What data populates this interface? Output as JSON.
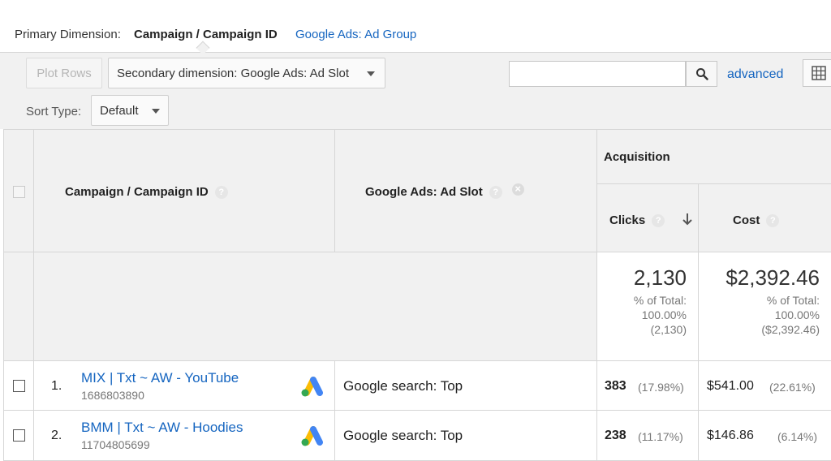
{
  "dimensions": {
    "label": "Primary Dimension:",
    "active": "Campaign / Campaign ID",
    "link": "Google Ads: Ad Group"
  },
  "toolbar": {
    "plot_rows": "Plot Rows",
    "secondary_dimension": "Secondary dimension: Google Ads: Ad Slot",
    "search_value": "",
    "advanced": "advanced",
    "sort_label": "Sort Type:",
    "sort_value": "Default"
  },
  "table": {
    "group_header": "Acquisition",
    "col_campaign": "Campaign / Campaign ID",
    "col_slot": "Google Ads: Ad Slot",
    "col_clicks": "Clicks",
    "col_cost": "Cost",
    "help_glyph": "?",
    "remove_glyph": "×",
    "totals": {
      "clicks": "2,130",
      "clicks_pct_label": "% of Total:",
      "clicks_pct": "100.00%",
      "clicks_abs": "(2,130)",
      "cost": "$2,392.46",
      "cost_pct_label": "% of Total:",
      "cost_pct": "100.00%",
      "cost_abs": "($2,392.46)"
    },
    "rows": [
      {
        "num": "1.",
        "name": "MIX | Txt ~ AW - YouTube",
        "id": "1686803890",
        "slot": "Google search: Top",
        "clicks": "383",
        "clicks_pct": "(17.98%)",
        "cost": "$541.00",
        "cost_pct": "(22.61%)"
      },
      {
        "num": "2.",
        "name": "BMM | Txt ~ AW - Hoodies",
        "id": "11704805699",
        "slot": "Google search: Top",
        "clicks": "238",
        "clicks_pct": "(11.17%)",
        "cost": "$146.86",
        "cost_pct": "(6.14%)"
      }
    ]
  },
  "icons": {
    "search": "search-icon",
    "grid": "table-grid-icon",
    "sort": "sort-down-arrow-icon",
    "google_ads": "google-ads-logo-icon"
  },
  "colors": {
    "link": "#1565c0",
    "ads_blue": "#4285f4",
    "ads_yellow": "#fbbc04",
    "ads_green": "#34a853"
  }
}
